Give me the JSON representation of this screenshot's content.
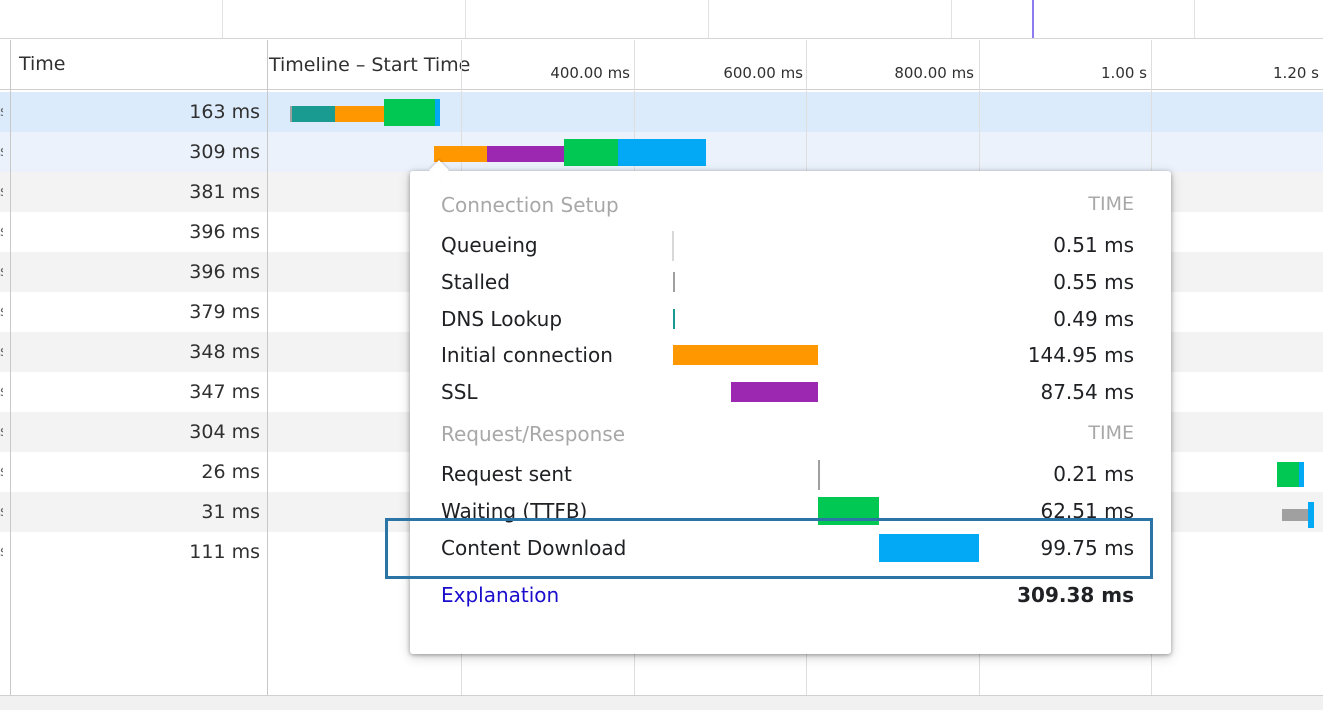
{
  "header": {
    "time_label": "Time",
    "timeline_label": "Timeline – Start Time",
    "ticks": [
      "400.00 ms",
      "600.00 ms",
      "800.00 ms",
      "1.00 s",
      "1.20 s"
    ]
  },
  "rows": [
    {
      "time": "163 ms"
    },
    {
      "time": "309 ms"
    },
    {
      "time": "381 ms"
    },
    {
      "time": "396 ms"
    },
    {
      "time": "396 ms"
    },
    {
      "time": "379 ms"
    },
    {
      "time": "348 ms"
    },
    {
      "time": "347 ms"
    },
    {
      "time": "304 ms"
    },
    {
      "time": "26 ms"
    },
    {
      "time": "31 ms"
    },
    {
      "time": "111 ms"
    }
  ],
  "row_lead_glyph": "s",
  "popover": {
    "connection_setup": {
      "title": "Connection Setup",
      "time_header": "TIME",
      "items": [
        {
          "label": "Queueing",
          "value": "0.51 ms"
        },
        {
          "label": "Stalled",
          "value": "0.55 ms"
        },
        {
          "label": "DNS Lookup",
          "value": "0.49 ms"
        },
        {
          "label": "Initial connection",
          "value": "144.95 ms"
        },
        {
          "label": "SSL",
          "value": "87.54 ms"
        }
      ]
    },
    "request_response": {
      "title": "Request/Response",
      "time_header": "TIME",
      "items": [
        {
          "label": "Request sent",
          "value": "0.21 ms"
        },
        {
          "label": "Waiting (TTFB)",
          "value": "62.51 ms"
        },
        {
          "label": "Content Download",
          "value": "99.75 ms"
        }
      ]
    },
    "explanation_link": "Explanation",
    "total": "309.38 ms"
  },
  "colors": {
    "queueing": "#d8d8d8",
    "stalled": "#a0a0a0",
    "dns": "#1a9b91",
    "initial_connection": "#ff9800",
    "ssl": "#9c27b0",
    "request_sent": "#a0a0a0",
    "waiting": "#00c853",
    "content_download": "#03a9f4",
    "highlight_border": "#2a75a6"
  }
}
